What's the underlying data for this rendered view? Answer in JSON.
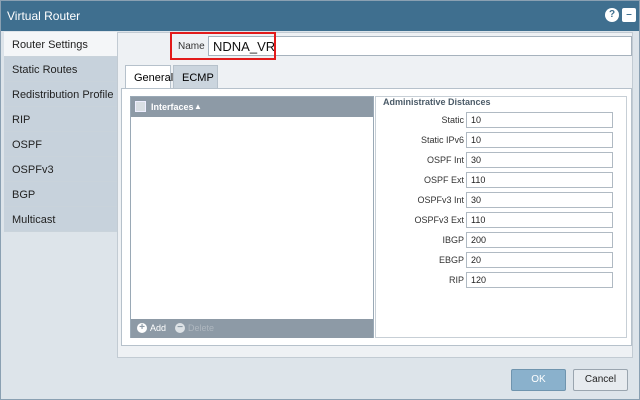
{
  "window": {
    "title": "Virtual Router"
  },
  "sidebar": {
    "items": [
      {
        "label": "Router Settings"
      },
      {
        "label": "Static Routes"
      },
      {
        "label": "Redistribution Profile"
      },
      {
        "label": "RIP"
      },
      {
        "label": "OSPF"
      },
      {
        "label": "OSPFv3"
      },
      {
        "label": "BGP"
      },
      {
        "label": "Multicast"
      }
    ]
  },
  "name_field": {
    "label": "Name",
    "value": "NDNA_VR"
  },
  "tabs": [
    {
      "label": "General"
    },
    {
      "label": "ECMP"
    }
  ],
  "interfaces": {
    "header": "Interfaces",
    "add_label": "Add",
    "delete_label": "Delete"
  },
  "admin": {
    "title": "Administrative Distances",
    "rows": [
      {
        "label": "Static",
        "value": "10"
      },
      {
        "label": "Static IPv6",
        "value": "10"
      },
      {
        "label": "OSPF Int",
        "value": "30"
      },
      {
        "label": "OSPF Ext",
        "value": "110"
      },
      {
        "label": "OSPFv3 Int",
        "value": "30"
      },
      {
        "label": "OSPFv3 Ext",
        "value": "110"
      },
      {
        "label": "IBGP",
        "value": "200"
      },
      {
        "label": "EBGP",
        "value": "20"
      },
      {
        "label": "RIP",
        "value": "120"
      }
    ]
  },
  "buttons": {
    "ok": "OK",
    "cancel": "Cancel"
  }
}
